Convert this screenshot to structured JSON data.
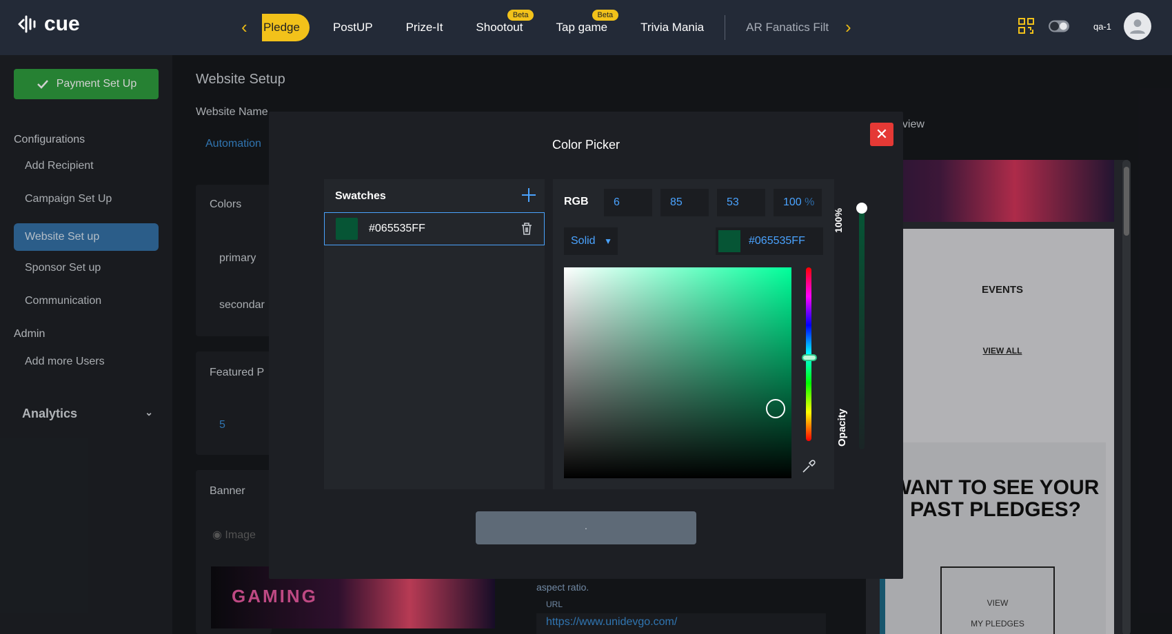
{
  "app": {
    "logo_text": "cue"
  },
  "nav": {
    "items": [
      {
        "label": "Pledge",
        "active": true
      },
      {
        "label": "PostUP"
      },
      {
        "label": "Prize-It"
      },
      {
        "label": "Shootout",
        "badge": "Beta"
      },
      {
        "label": "Tap game",
        "badge": "Beta"
      },
      {
        "label": "Trivia Mania"
      },
      {
        "label": "AR Fanatics Filt",
        "dim": true
      }
    ],
    "user_name": "qa-1"
  },
  "sidebar": {
    "payment_button": "Payment Set Up",
    "configurations_label": "Configurations",
    "items": [
      {
        "label": "Add Recipient"
      },
      {
        "label": "Campaign Set Up"
      },
      {
        "label": "Website Set up",
        "active": true
      },
      {
        "label": "Sponsor Set up"
      },
      {
        "label": "Communication"
      }
    ],
    "admin_label": "Admin",
    "admin_items": [
      {
        "label": "Add more Users"
      }
    ],
    "analytics_label": "Analytics"
  },
  "main": {
    "title": "Website Setup",
    "website_name_label": "Website Name",
    "website_name_value": "Automation",
    "colors_label": "Colors",
    "primary_label": "primary",
    "secondary_label": "secondar",
    "featured_label": "Featured P",
    "featured_value": "5",
    "banner_label": "Banner",
    "image_option": "Image",
    "aspect_ratio_text": "aspect ratio.",
    "url_label": "URL",
    "url_value": "https://www.unidevgo.com/",
    "preview_label": "eview"
  },
  "preview": {
    "events": "EVENTS",
    "view_all": "VIEW ALL",
    "want_title": "WANT TO SEE YOUR PAST PLEDGES?",
    "view_pledges_line1": "VIEW",
    "view_pledges_line2": "MY PLEDGES",
    "banner_text": "GAMING"
  },
  "modal": {
    "title": "Color Picker",
    "swatches_label": "Swatches",
    "swatch_hex": "#065535FF",
    "rgb_label": "RGB",
    "r": "6",
    "g": "85",
    "b": "53",
    "alpha": "100",
    "alpha_unit": "%",
    "mode": "Solid",
    "hex_value": "#065535FF",
    "opacity_percent": "100%",
    "opacity_label": "Opacity",
    "selected_color": "#065535",
    "hue_level": 0.52,
    "opacity_level": 1.0,
    "saturation": 0.93,
    "brightness": 0.33
  },
  "colors": {
    "accent": "#f2c21a",
    "primary_blue": "#3572a8",
    "success": "#2f9e3f",
    "danger": "#e53935"
  }
}
